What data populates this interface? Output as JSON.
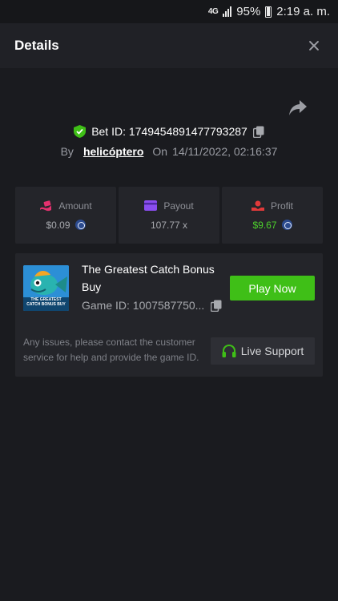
{
  "status_bar": {
    "network": "4G",
    "battery": "95%",
    "time": "2:19 a. m."
  },
  "header": {
    "title": "Details"
  },
  "bet": {
    "id_label": "Bet ID: 1749454891477793287",
    "by_label": "By",
    "username": "helicóptero",
    "on_label": "On",
    "date": "14/11/2022, 02:16:37"
  },
  "stats": [
    {
      "label": "Amount",
      "value": "$0.09",
      "icon": "money-wave-icon"
    },
    {
      "label": "Payout",
      "value": "107.77 x",
      "icon": "card-icon"
    },
    {
      "label": "Profit",
      "value": "$9.67",
      "icon": "hand-coin-icon"
    }
  ],
  "game": {
    "title": "The Greatest Catch Bonus Buy",
    "id": "Game ID: 1007587750...",
    "thumbnail_text": "THE GREATEST CATCH BONUS BUY",
    "play_label": "Play Now",
    "issues_text": "Any issues, please contact the customer service for help and provide the game ID.",
    "support_label": "Live Support"
  },
  "colors": {
    "background": "#1a1b1f",
    "header": "#202126",
    "card": "#24252a",
    "accent_green": "#3fbf17",
    "profit_green": "#4dd02c",
    "amount_icon": "#e5316f",
    "payout_icon": "#8a4df0",
    "profit_icon": "#e13a3a"
  }
}
